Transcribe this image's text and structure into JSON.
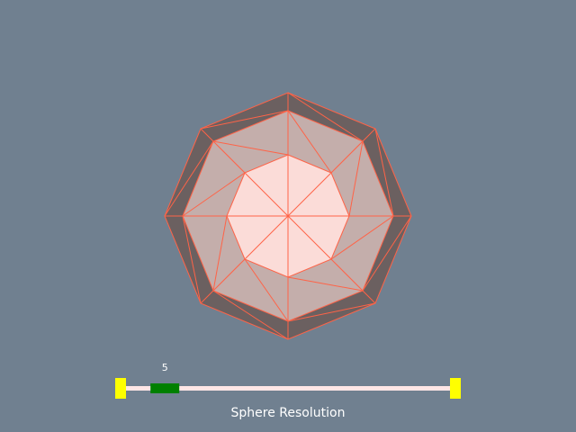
{
  "scene": {
    "background_color": "#708090",
    "object": "sphere-mesh",
    "edge_color": "#ff6347",
    "colors": {
      "outer": "#6b6060",
      "middle": "#c4aeab",
      "inner": "#fbdcd8"
    }
  },
  "slider": {
    "title": "Sphere Resolution",
    "value": "5",
    "fraction": 0.12,
    "track_color": "#ffe6e6",
    "knob_color": "#008000",
    "cap_color": "#ffff00"
  }
}
